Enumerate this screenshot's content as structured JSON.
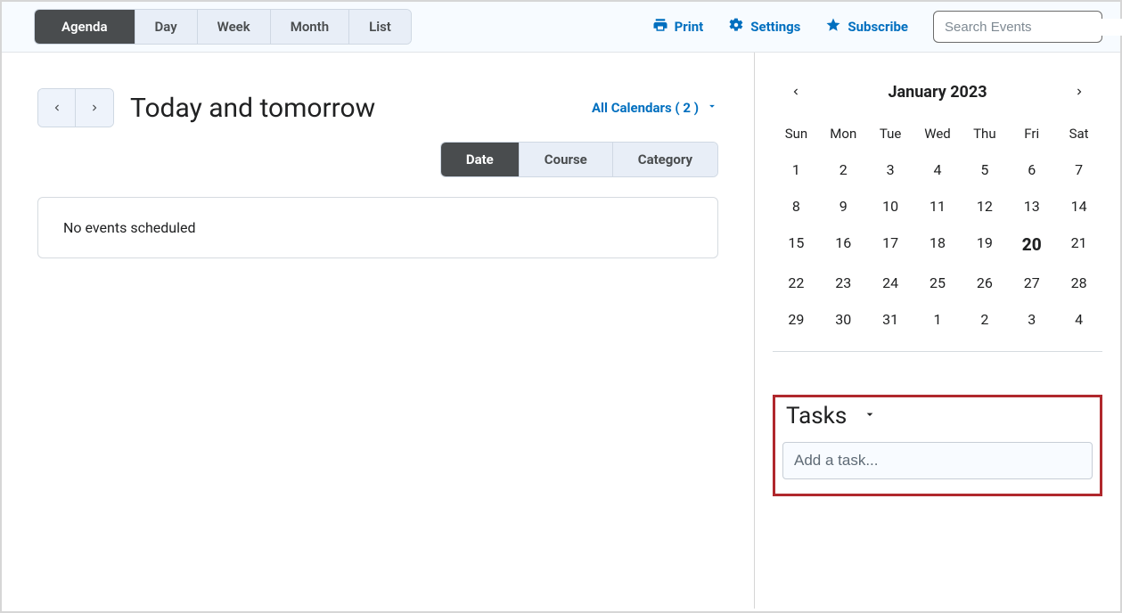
{
  "topbar": {
    "tabs": [
      "Agenda",
      "Day",
      "Week",
      "Month",
      "List"
    ],
    "active_tab_index": 0,
    "print": "Print",
    "settings": "Settings",
    "subscribe": "Subscribe",
    "search_placeholder": "Search Events"
  },
  "main": {
    "title": "Today and tomorrow",
    "calendars_link": "All Calendars ( 2 )",
    "group_tabs": [
      "Date",
      "Course",
      "Category"
    ],
    "active_group_index": 0,
    "no_events": "No events scheduled"
  },
  "calendar": {
    "month_label": "January 2023",
    "dow": [
      "Sun",
      "Mon",
      "Tue",
      "Wed",
      "Thu",
      "Fri",
      "Sat"
    ],
    "days": [
      "1",
      "2",
      "3",
      "4",
      "5",
      "6",
      "7",
      "8",
      "9",
      "10",
      "11",
      "12",
      "13",
      "14",
      "15",
      "16",
      "17",
      "18",
      "19",
      "20",
      "21",
      "22",
      "23",
      "24",
      "25",
      "26",
      "27",
      "28",
      "29",
      "30",
      "31",
      "1",
      "2",
      "3",
      "4"
    ],
    "today_index": 19
  },
  "tasks": {
    "title": "Tasks",
    "input_placeholder": "Add a task..."
  }
}
